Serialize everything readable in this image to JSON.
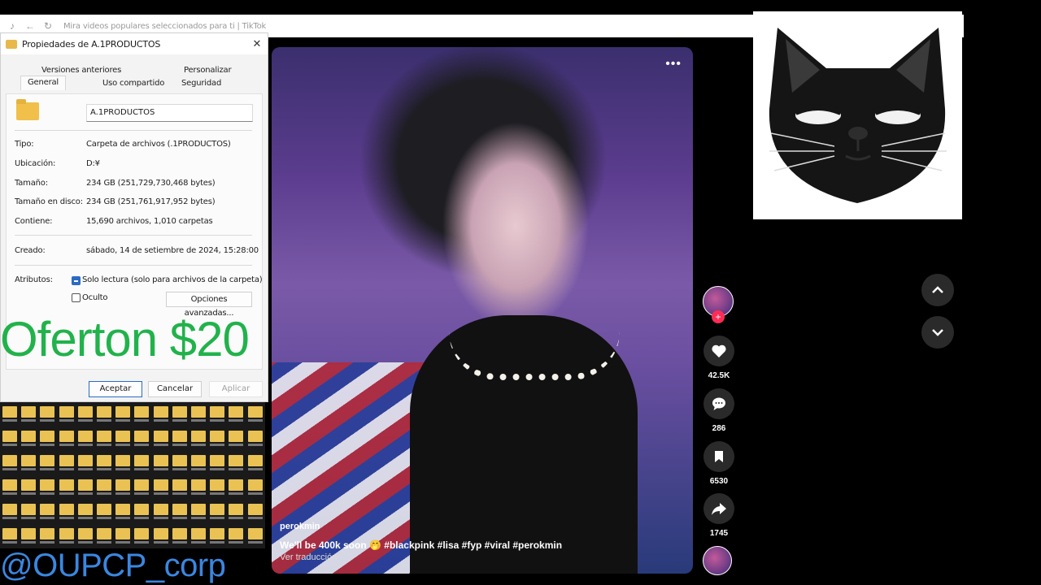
{
  "browser": {
    "title": "Mira videos populares seleccionados para ti | TikTok",
    "icons": [
      "tiktok-icon",
      "back-arrow-icon",
      "reload-icon"
    ]
  },
  "dialog": {
    "title": "Propiedades de A.1PRODUCTOS",
    "tabs": {
      "previous_versions": "Versiones anteriores",
      "customize": "Personalizar",
      "general": "General",
      "sharing": "Uso compartido",
      "security": "Seguridad"
    },
    "folder_name": "A.1PRODUCTOS",
    "fields": {
      "type_label": "Tipo:",
      "type_value": "Carpeta de archivos (.1PRODUCTOS)",
      "location_label": "Ubicación:",
      "location_value": "D:¥",
      "size_label": "Tamaño:",
      "size_value": "234 GB (251,729,730,468 bytes)",
      "disk_size_label": "Tamaño en disco:",
      "disk_size_value": "234 GB (251,761,917,952 bytes)",
      "contains_label": "Contiene:",
      "contains_value": "15,690 archivos, 1,010 carpetas",
      "created_label": "Creado:",
      "created_value": "sábado, 14 de setiembre de 2024, 15:28:00",
      "attributes_label": "Atributos:",
      "readonly_label": "Solo lectura (solo para archivos de la carpeta)",
      "readonly_checked": true,
      "hidden_label": "Oculto",
      "hidden_checked": false,
      "advanced_button": "Opciones avanzadas..."
    },
    "buttons": {
      "accept": "Aceptar",
      "cancel": "Cancelar",
      "apply": "Aplicar"
    }
  },
  "promo_text": "Oferton $20",
  "watermark": "@OUPCP_corp",
  "video": {
    "author": "perokmin",
    "caption": "We'll be 400k soon 🤭 #blackpink #lisa #fyp #viral #perokmin",
    "translate_link": "Ver traducción"
  },
  "actions": {
    "likes": "42.5K",
    "comments": "286",
    "saves": "6530",
    "shares": "1745"
  },
  "colors": {
    "promo_green": "#22b24c",
    "watermark_blue": "#3a87e0",
    "tiktok_red": "#fe2c55"
  }
}
